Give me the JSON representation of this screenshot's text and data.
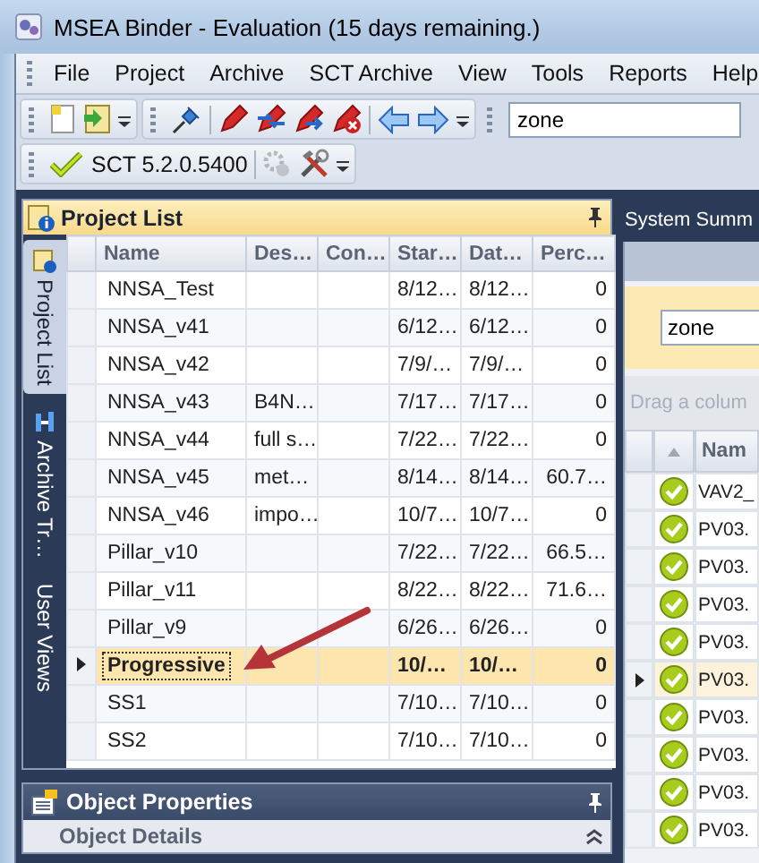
{
  "window": {
    "title": "MSEA Binder - Evaluation (15 days remaining.)"
  },
  "menu": [
    "File",
    "Project",
    "Archive",
    "SCT Archive",
    "View",
    "Tools",
    "Reports",
    "Help"
  ],
  "toolbar": {
    "search": {
      "value": "zone"
    },
    "version": "SCT 5.2.0.5400",
    "settings_disabled": true
  },
  "project_list": {
    "title": "Project List",
    "side_tabs": [
      {
        "label": "Project List",
        "selected": true
      },
      {
        "label": "Archive Tr…",
        "selected": false
      },
      {
        "label": "User Views",
        "selected": false
      }
    ],
    "columns": [
      "Name",
      "Des…",
      "Con…",
      "Star…",
      "Dat…",
      "Perc…"
    ],
    "rows": [
      {
        "name": "NNSA_Test",
        "start": "8/12…",
        "date": "8/12…",
        "percent": "0",
        "selected": false
      },
      {
        "name": "NNSA_v41",
        "start": "6/12…",
        "date": "6/12…",
        "percent": "0",
        "selected": false
      },
      {
        "name": "NNSA_v42",
        "start": "7/9/…",
        "date": "7/9/…",
        "percent": "0",
        "selected": false
      },
      {
        "name": "NNSA_v43",
        "description": "B4N…",
        "start": "7/17…",
        "date": "7/17…",
        "percent": "0",
        "selected": false
      },
      {
        "name": "NNSA_v44",
        "description": "full s…",
        "start": "7/22…",
        "date": "7/22…",
        "percent": "0",
        "selected": false
      },
      {
        "name": "NNSA_v45",
        "description": "met…",
        "start": "8/14…",
        "date": "8/14…",
        "percent": "60.7…",
        "selected": false
      },
      {
        "name": "NNSA_v46",
        "description": "impo…",
        "start": "10/7…",
        "date": "10/7…",
        "percent": "0",
        "selected": false
      },
      {
        "name": "Pillar_v10",
        "start": "7/22…",
        "date": "7/22…",
        "percent": "66.5…",
        "selected": false
      },
      {
        "name": "Pillar_v11",
        "start": "8/22…",
        "date": "8/22…",
        "percent": "71.6…",
        "selected": false
      },
      {
        "name": "Pillar_v9",
        "start": "6/26…",
        "date": "6/26…",
        "percent": "0",
        "selected": false
      },
      {
        "name": "Progressive",
        "start": "10/…",
        "date": "10/…",
        "percent": "0",
        "selected": true
      },
      {
        "name": "SS1",
        "start": "7/10…",
        "date": "7/10…",
        "percent": "0",
        "selected": false
      },
      {
        "name": "SS2",
        "start": "7/10…",
        "date": "7/10…",
        "percent": "0",
        "selected": false
      }
    ]
  },
  "object_properties": {
    "title": "Object Properties",
    "section": "Object Details"
  },
  "system_summary": {
    "tab": "System Summ",
    "filter": {
      "value": "zone"
    },
    "group_hint": "Drag a colum",
    "columns": [
      "Nam"
    ],
    "rows": [
      {
        "name": "VAV2_",
        "selected": false
      },
      {
        "name": "PV03.",
        "selected": false
      },
      {
        "name": "PV03.",
        "selected": false
      },
      {
        "name": "PV03.",
        "selected": false
      },
      {
        "name": "PV03.",
        "selected": false
      },
      {
        "name": "PV03.",
        "selected": true
      },
      {
        "name": "PV03.",
        "selected": false
      },
      {
        "name": "PV03.",
        "selected": false
      },
      {
        "name": "PV03.",
        "selected": false
      },
      {
        "name": "PV03.",
        "selected": false
      }
    ]
  }
}
